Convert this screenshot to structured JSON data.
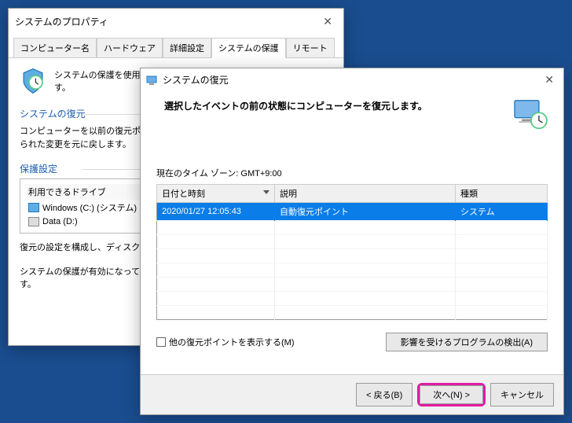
{
  "background": {
    "window": {
      "title": "システムのプロパティ",
      "tabs": [
        "コンピューター名",
        "ハードウェア",
        "詳細設定",
        "システムの保護",
        "リモート"
      ],
      "activeTab": 3,
      "intro": "システムの保護を使用して、システムに加えた不要な変更を元に戻します。",
      "section_restore": {
        "title": "システムの復元",
        "desc": "コンピューターを以前の復元ポイントの状態に戻すことにより、システムに加えられた変更を元に戻します。"
      },
      "section_protect": {
        "title": "保護設定",
        "groupTitle": "利用できるドライブ",
        "drives": [
          {
            "label": "Windows (C:) (システム)",
            "icon": "blue"
          },
          {
            "label": "Data (D:)",
            "icon": "gray"
          }
        ],
        "para1": "復元の設定を構成し、ディスク領域を管理して、復元ポイントを削除します。",
        "para2": "システムの保護が有効になっているドライブの復元ポイントを今すぐ作成します。"
      }
    }
  },
  "restore": {
    "title": "システムの復元",
    "heading": "選択したイベントの前の状態にコンピューターを復元します。",
    "timezone": "現在のタイム ゾーン: GMT+9:00",
    "columns": [
      "日付と時刻",
      "説明",
      "種類"
    ],
    "rows": [
      {
        "date": "2020/01/27 12:05:43",
        "desc": "自動復元ポイント",
        "kind": "システム"
      }
    ],
    "showMore": "他の復元ポイントを表示する(M)",
    "scanBtn": "影響を受けるプログラムの検出(A)",
    "buttons": {
      "back": "< 戻る(B)",
      "next": "次へ(N) >",
      "cancel": "キャンセル"
    }
  }
}
